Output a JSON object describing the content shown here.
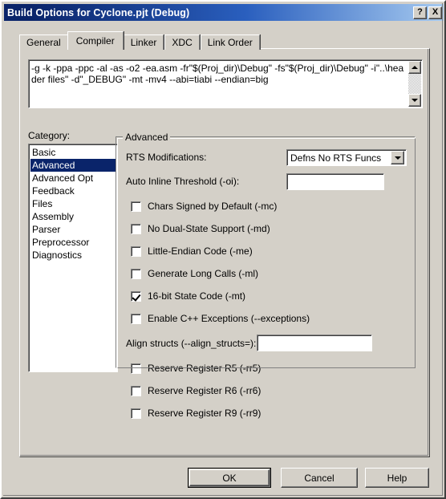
{
  "window": {
    "title": "Build Options for Cyclone.pjt (Debug)",
    "help_button": "?",
    "close_button": "X",
    "titlebar_color": "#0a246a",
    "face_color": "#d4d0c8",
    "highlight_color": "#0a246a"
  },
  "tabs": [
    {
      "label": "General",
      "active": false
    },
    {
      "label": "Compiler",
      "active": true
    },
    {
      "label": "Linker",
      "active": false
    },
    {
      "label": "XDC",
      "active": false
    },
    {
      "label": "Link Order",
      "active": false
    }
  ],
  "command_line": {
    "value": "-g -k -ppa -ppc -al -as -o2 -ea.asm -fr\"$(Proj_dir)\\Debug\" -fs\"$(Proj_dir)\\Debug\" -i\"..\\header files\" -d\"_DEBUG\" -mt -mv4 --abi=tiabi --endian=big",
    "scroll_up_icon": "triangle-up-icon",
    "scroll_down_icon": "triangle-down-icon"
  },
  "category": {
    "label": "Category:",
    "selected": "Advanced",
    "items": [
      "Basic",
      "Advanced",
      "Advanced Opt",
      "Feedback",
      "Files",
      "Assembly",
      "Parser",
      "Preprocessor",
      "Diagnostics"
    ]
  },
  "advanced": {
    "group_title": "Advanced",
    "rts_modifications": {
      "label": "RTS Modifications:",
      "value": "Defns No RTS Funcs",
      "dropdown_icon": "chevron-down-icon"
    },
    "auto_inline_threshold": {
      "label": "Auto Inline Threshold (-oi):",
      "value": "",
      "placeholder": ""
    },
    "checkboxes": [
      {
        "label": "Chars Signed by Default (-mc)",
        "checked": false
      },
      {
        "label": "No Dual-State Support (-md)",
        "checked": false
      },
      {
        "label": "Little-Endian Code (-me)",
        "checked": false
      },
      {
        "label": "Generate Long Calls (-ml)",
        "checked": false
      },
      {
        "label": "16-bit State Code (-mt)",
        "checked": true
      },
      {
        "label": "Enable C++ Exceptions (--exceptions)",
        "checked": false
      }
    ],
    "align_structs": {
      "label": "Align structs (--align_structs=):",
      "value": "",
      "placeholder": ""
    },
    "reserve_checkboxes": [
      {
        "label": "Reserve Register R5 (-rr5)",
        "checked": false
      },
      {
        "label": "Reserve Register R6 (-rr6)",
        "checked": false
      },
      {
        "label": "Reserve Register R9 (-rr9)",
        "checked": false
      }
    ]
  },
  "buttons": {
    "ok": "OK",
    "cancel": "Cancel",
    "help": "Help"
  }
}
